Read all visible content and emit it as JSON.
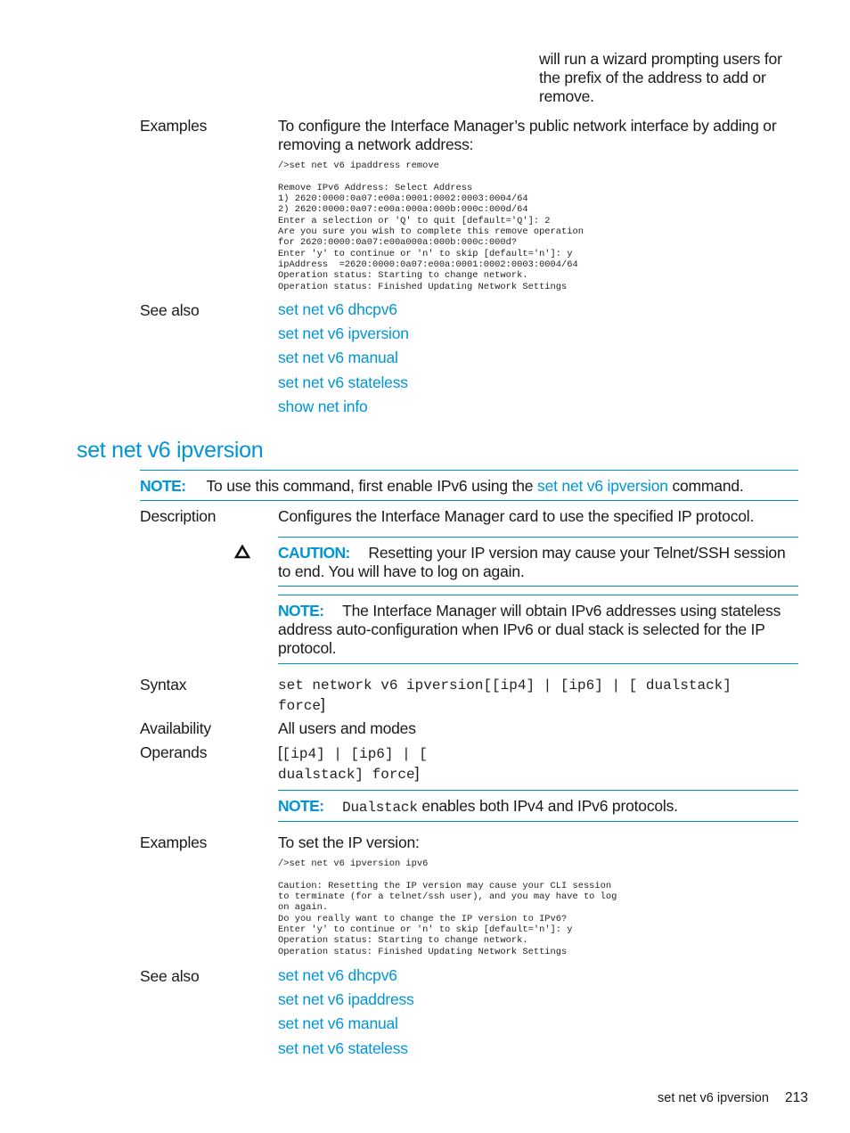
{
  "continuation_text": "will run a wizard prompting users for the prefix of the address to add or remove.",
  "ipaddress_section": {
    "examples_label": "Examples",
    "examples_intro": "To configure the Interface Manager’s public network interface by adding or removing a network address:",
    "examples_code": "/>set net v6 ipaddress remove\n\nRemove IPv6 Address: Select Address\n1) 2620:0000:0a07:e00a:0001:0002:0003:0004/64\n2) 2620:0000:0a07:e00a:000a:000b:000c:000d/64\nEnter a selection or 'Q' to quit [default='Q']: 2\nAre you sure you wish to complete this remove operation\nfor 2620:0000:0a07:e00a000a:000b:000c:000d?\nEnter 'y' to continue or 'n' to skip [default='n']: y\nipAddress  =2620:0000:0a07:e00a:0001:0002:0003:0004/64\nOperation status: Starting to change network.\nOperation status: Finished Updating Network Settings",
    "see_also_label": "See also",
    "see_also": [
      "set net v6 dhcpv6",
      "set net v6 ipversion",
      "set net v6 manual",
      "set net v6 stateless",
      "show net info"
    ]
  },
  "ipversion_section": {
    "title": "set net v6 ipversion",
    "top_note": {
      "label": "NOTE:",
      "text_before": "To use this command, first enable IPv6 using the",
      "link": "set net v6 ipversion",
      "text_after": "command."
    },
    "description_label": "Description",
    "description": "Configures the Interface Manager card to use the specified IP protocol.",
    "caution": {
      "icon": "caution-triangle-icon",
      "label": "CAUTION:",
      "text": "Resetting your IP version may cause your Telnet/SSH session to end. You will have to log on again."
    },
    "desc_note": {
      "label": "NOTE:",
      "text": "The Interface Manager will obtain IPv6 addresses using stateless address auto-configuration when IPv6 or dual stack is selected for the IP protocol."
    },
    "syntax_label": "Syntax",
    "syntax_line1_code": "set network v6 ipversion",
    "syntax_line1_rest": "[[ip4] | [ip6] | [ dualstack]",
    "syntax_line2_code": "force",
    "syntax_line2_bracket": "]",
    "availability_label": "Availability",
    "availability": "All users and modes",
    "operands_label": "Operands",
    "operands_line1_bracket": "[",
    "operands_line1_code": "[ip4] | [ip6] | [",
    "operands_line2_code": "dualstack] force",
    "operands_line2_bracket": "]",
    "operands_note": {
      "label": "NOTE:",
      "code": "Dualstack",
      "text": "enables both IPv4 and IPv6 protocols."
    },
    "examples_label": "Examples",
    "examples_intro": "To set the IP version:",
    "examples_code": "/>set net v6 ipversion ipv6\n\nCaution: Resetting the IP version may cause your CLI session\nto terminate (for a telnet/ssh user), and you may have to log\non again.\nDo you really want to change the IP version to IPv6?\nEnter 'y' to continue or 'n' to skip [default='n']: y\nOperation status: Starting to change network.\nOperation status: Finished Updating Network Settings",
    "see_also_label": "See also",
    "see_also": [
      "set net v6 dhcpv6",
      "set net v6 ipaddress",
      "set net v6 manual",
      "set net v6 stateless"
    ]
  },
  "footer": {
    "section_title": "set net v6 ipversion",
    "page_number": "213"
  },
  "colors": {
    "accent": "#0096d6",
    "text": "#1a1a1a"
  }
}
